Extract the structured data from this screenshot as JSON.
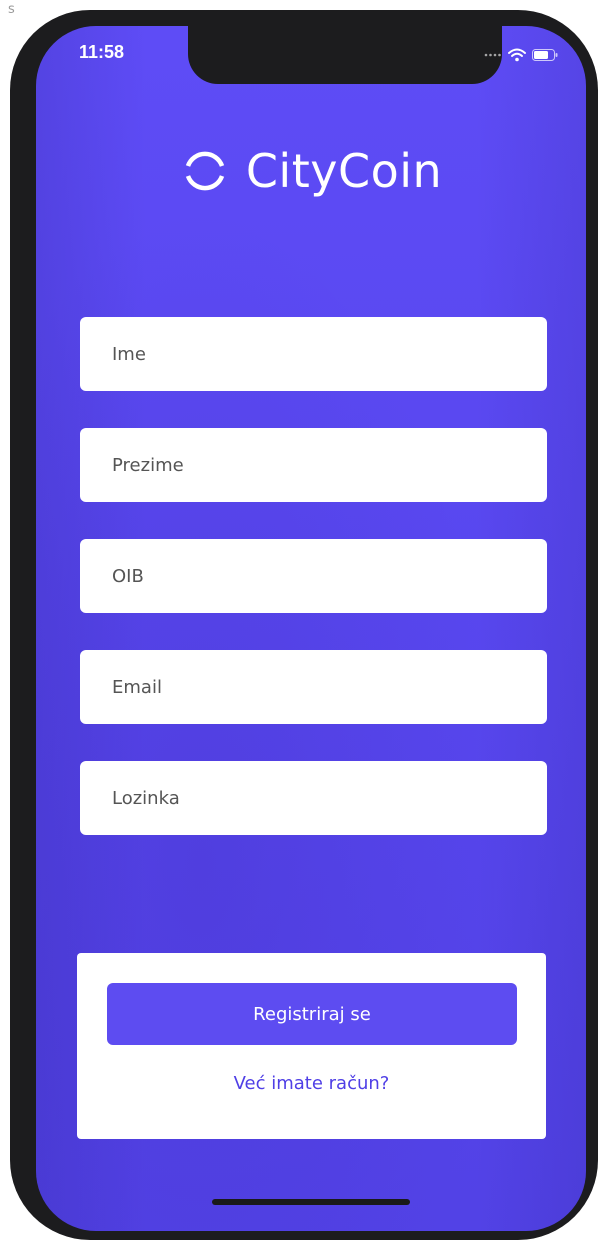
{
  "frame_label": "s",
  "status_bar": {
    "time": "11:58"
  },
  "brand": {
    "name": "CityCoin"
  },
  "form": {
    "fields": [
      {
        "placeholder": "Ime"
      },
      {
        "placeholder": "Prezime"
      },
      {
        "placeholder": "OIB"
      },
      {
        "placeholder": "Email"
      },
      {
        "placeholder": "Lozinka"
      }
    ],
    "register_label": "Registriraj se",
    "login_link": "Već imate račun?"
  },
  "colors": {
    "accent": "#5d4cf1",
    "background": "#5847ef",
    "link": "#4f3fe6"
  },
  "icons": [
    "logo-ring-icon",
    "wifi-icon",
    "battery-icon",
    "signal-dots-icon"
  ]
}
